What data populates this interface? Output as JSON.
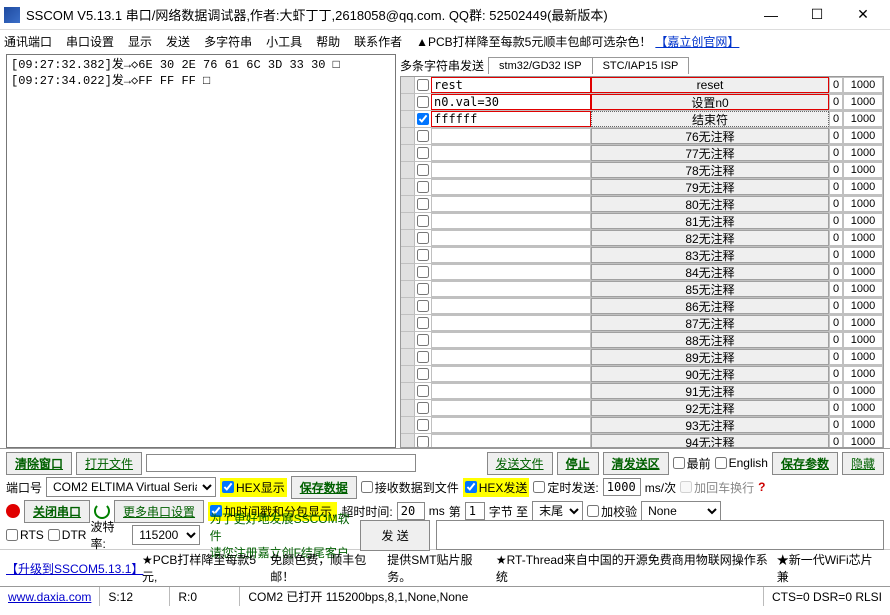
{
  "window": {
    "title": "SSCOM V5.13.1 串口/网络数据调试器,作者:大虾丁丁,2618058@qq.com. QQ群: 52502449(最新版本)",
    "min": "—",
    "max": "☐",
    "close": "✕"
  },
  "menu": {
    "items": [
      "通讯端口",
      "串口设置",
      "显示",
      "发送",
      "多字符串",
      "小工具",
      "帮助",
      "联系作者"
    ],
    "promo": "▲PCB打样降至每款5元顺丰包邮可选杂色！",
    "link": "【嘉立创官网】"
  },
  "log": [
    "[09:27:32.382]发→◇6E 30 2E 76 61 6C 3D 33 30 □",
    "[09:27:34.022]发→◇FF FF FF □"
  ],
  "rtabs": {
    "label": "多条字符串发送",
    "items": [
      "stm32/GD32 ISP",
      "STC/IAP15 ISP"
    ]
  },
  "rows": [
    {
      "text": "rest",
      "btn": "reset",
      "n": "0",
      "ms": "1000",
      "chk": false,
      "boxed": true
    },
    {
      "text": "n0.val=30",
      "btn": "设置n0",
      "n": "0",
      "ms": "1000",
      "chk": false,
      "boxed": true
    },
    {
      "text": "ffffff",
      "btn": "结束符",
      "n": "0",
      "ms": "1000",
      "chk": true,
      "boxed": true,
      "dotted": true
    },
    {
      "text": "",
      "btn": "76无注释",
      "n": "0",
      "ms": "1000",
      "chk": false
    },
    {
      "text": "",
      "btn": "77无注释",
      "n": "0",
      "ms": "1000",
      "chk": false
    },
    {
      "text": "",
      "btn": "78无注释",
      "n": "0",
      "ms": "1000",
      "chk": false
    },
    {
      "text": "",
      "btn": "79无注释",
      "n": "0",
      "ms": "1000",
      "chk": false
    },
    {
      "text": "",
      "btn": "80无注释",
      "n": "0",
      "ms": "1000",
      "chk": false
    },
    {
      "text": "",
      "btn": "81无注释",
      "n": "0",
      "ms": "1000",
      "chk": false
    },
    {
      "text": "",
      "btn": "82无注释",
      "n": "0",
      "ms": "1000",
      "chk": false
    },
    {
      "text": "",
      "btn": "83无注释",
      "n": "0",
      "ms": "1000",
      "chk": false
    },
    {
      "text": "",
      "btn": "84无注释",
      "n": "0",
      "ms": "1000",
      "chk": false
    },
    {
      "text": "",
      "btn": "85无注释",
      "n": "0",
      "ms": "1000",
      "chk": false
    },
    {
      "text": "",
      "btn": "86无注释",
      "n": "0",
      "ms": "1000",
      "chk": false
    },
    {
      "text": "",
      "btn": "87无注释",
      "n": "0",
      "ms": "1000",
      "chk": false
    },
    {
      "text": "",
      "btn": "88无注释",
      "n": "0",
      "ms": "1000",
      "chk": false
    },
    {
      "text": "",
      "btn": "89无注释",
      "n": "0",
      "ms": "1000",
      "chk": false
    },
    {
      "text": "",
      "btn": "90无注释",
      "n": "0",
      "ms": "1000",
      "chk": false
    },
    {
      "text": "",
      "btn": "91无注释",
      "n": "0",
      "ms": "1000",
      "chk": false
    },
    {
      "text": "",
      "btn": "92无注释",
      "n": "0",
      "ms": "1000",
      "chk": false
    },
    {
      "text": "",
      "btn": "93无注释",
      "n": "0",
      "ms": "1000",
      "chk": false
    },
    {
      "text": "",
      "btn": "94无注释",
      "n": "0",
      "ms": "1000",
      "chk": false
    }
  ],
  "bb": {
    "clear": "清除窗口",
    "openfile": "打开文件",
    "filepath": "",
    "sendfile": "发送文件",
    "stop": "停止",
    "clearsend": "清发送区",
    "top": "最前",
    "english": "English",
    "saveparam": "保存参数",
    "hide": "隐藏",
    "portlbl": "端口号",
    "port": "COM2 ELTIMA Virtual Serial",
    "hexshow": "HEX显示",
    "savedata": "保存数据",
    "rxtofile": "接收数据到文件",
    "hexsend": "HEX发送",
    "timedsend": "定时发送:",
    "sendms": "1000",
    "msper": "ms/次",
    "crlf": "加回车换行",
    "closeport": "关闭串口",
    "moreport": "更多串口设置",
    "addtime": "加时间戳和分包显示,",
    "timeoutlbl": "超时时间:",
    "timeout": "20",
    "msunit": "ms",
    "bytelbl": "第",
    "byteidx": "1",
    "byteunit": "字节 至",
    "tail": "末尾",
    "addchk": "加校验",
    "chk": "None",
    "rts": "RTS",
    "dtr": "DTR",
    "baudlbl": "波特率:",
    "baud": "115200",
    "green1": "为了更好地发展SSCOM软件",
    "green2": "请您注册嘉立创F结尾客户",
    "send": "发   送"
  },
  "foot": {
    "upgrade": "【升级到SSCOM5.13.1】",
    "p1": "★PCB打样降至每款5元,",
    "p2": "免颜色费，顺丰包邮！",
    "p3": "提供SMT贴片服务。",
    "p4": "★RT-Thread来自中国的开源免费商用物联网操作系统",
    "p5": "★新一代WiFi芯片兼"
  },
  "status": {
    "url": "www.daxia.com",
    "s": "S:12",
    "r": "R:0",
    "port": "COM2 已打开 115200bps,8,1,None,None",
    "cts": "CTS=0 DSR=0 RLSI"
  }
}
